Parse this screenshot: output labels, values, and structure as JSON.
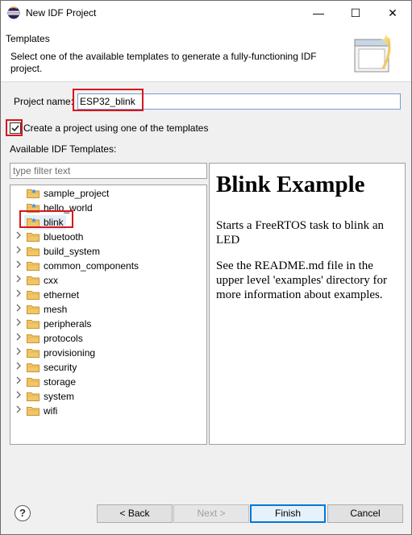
{
  "window": {
    "title": "New IDF Project",
    "minimize_glyph": "—",
    "maximize_glyph": "☐",
    "close_glyph": "✕"
  },
  "banner": {
    "title": "Templates",
    "description": "Select one of the available templates to generate a fully-functioning IDF project."
  },
  "form": {
    "project_name_label": "Project name:",
    "project_name_value": "ESP32_blink",
    "use_template_label": "Create a project using one of the templates",
    "use_template_checked": true,
    "available_label": "Available IDF Templates:",
    "filter_placeholder": "type filter text"
  },
  "tree": {
    "items": [
      {
        "label": "sample_project",
        "expandable": false,
        "selected": false
      },
      {
        "label": "hello_world",
        "expandable": false,
        "selected": false
      },
      {
        "label": "blink",
        "expandable": false,
        "selected": true
      },
      {
        "label": "bluetooth",
        "expandable": true,
        "selected": false
      },
      {
        "label": "build_system",
        "expandable": true,
        "selected": false
      },
      {
        "label": "common_components",
        "expandable": true,
        "selected": false
      },
      {
        "label": "cxx",
        "expandable": true,
        "selected": false
      },
      {
        "label": "ethernet",
        "expandable": true,
        "selected": false
      },
      {
        "label": "mesh",
        "expandable": true,
        "selected": false
      },
      {
        "label": "peripherals",
        "expandable": true,
        "selected": false
      },
      {
        "label": "protocols",
        "expandable": true,
        "selected": false
      },
      {
        "label": "provisioning",
        "expandable": true,
        "selected": false
      },
      {
        "label": "security",
        "expandable": true,
        "selected": false
      },
      {
        "label": "storage",
        "expandable": true,
        "selected": false
      },
      {
        "label": "system",
        "expandable": true,
        "selected": false
      },
      {
        "label": "wifi",
        "expandable": true,
        "selected": false
      }
    ]
  },
  "preview": {
    "heading": "Blink Example",
    "para1": "Starts a FreeRTOS task to blink an LED",
    "para2": "See the README.md file in the upper level 'examples' directory for more information about examples."
  },
  "buttons": {
    "help": "?",
    "back": "< Back",
    "next": "Next >",
    "finish": "Finish",
    "cancel": "Cancel"
  },
  "colors": {
    "highlight_box": "#d8161c",
    "folder_fill": "#f1c66a",
    "selection_bg": "#e5eef8"
  }
}
